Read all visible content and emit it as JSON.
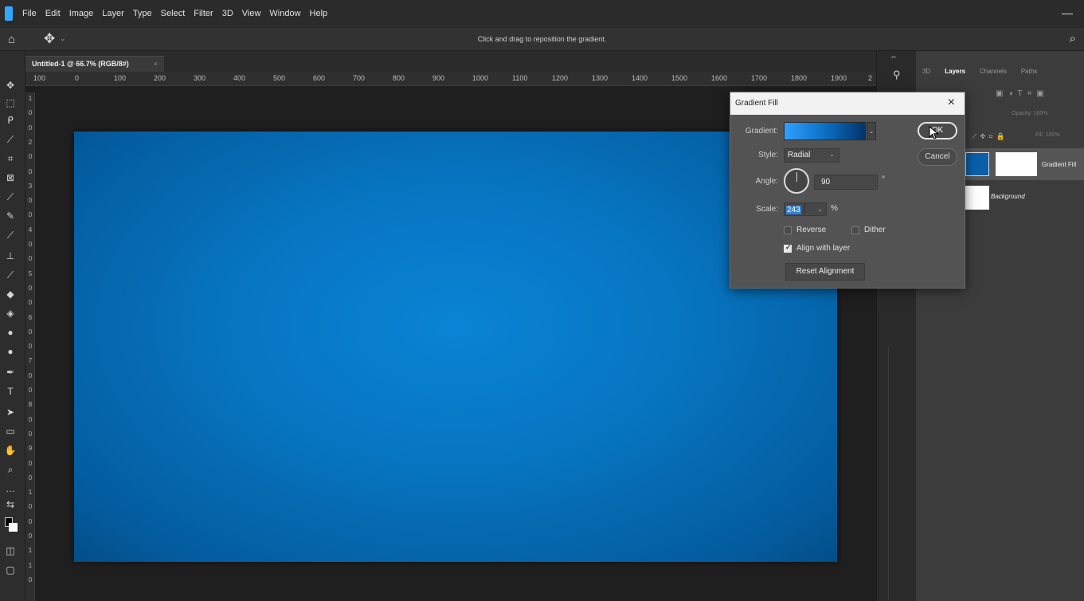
{
  "app": {
    "menu": [
      "File",
      "Edit",
      "Image",
      "Layer",
      "Type",
      "Select",
      "Filter",
      "3D",
      "View",
      "Window",
      "Help"
    ],
    "minimize_glyph": "—"
  },
  "options_bar": {
    "hint": "Click and drag to reposition the gradient."
  },
  "document": {
    "tab_title": "Untitled-1 @ 66.7% (RGB/8#)",
    "tab_close": "×"
  },
  "rulers": {
    "horizontal": [
      "100",
      "0",
      "100",
      "200",
      "300",
      "400",
      "500",
      "600",
      "700",
      "800",
      "900",
      "1000",
      "1100",
      "1200",
      "1300",
      "1400",
      "1500",
      "1600",
      "1700",
      "1800",
      "1900",
      "2"
    ],
    "vertical": [
      "1",
      "0",
      "0",
      "2",
      "0",
      "0",
      "3",
      "0",
      "0",
      "4",
      "0",
      "0",
      "5",
      "0",
      "0",
      "6",
      "0",
      "0",
      "7",
      "0",
      "0",
      "8",
      "0",
      "0",
      "9",
      "0",
      "0",
      "1",
      "0",
      "0",
      "0",
      "1",
      "1",
      "0"
    ]
  },
  "canvas": {
    "gradient_center_color": "#0a84d4",
    "gradient_edge_color": "#034d88"
  },
  "panels": {
    "tabs": [
      "3D",
      "Layers",
      "Channels",
      "Paths"
    ],
    "opacity_label": "Opacity: 100%",
    "fill_label": "Fill: 100%",
    "layers": [
      {
        "name": "Gradient Fill",
        "selected": true
      },
      {
        "name": "Background",
        "selected": false
      }
    ]
  },
  "dialog": {
    "title": "Gradient Fill",
    "close_glyph": "×",
    "gradient_label": "Gradient:",
    "style_label": "Style:",
    "style_value": "Radial",
    "angle_label": "Angle:",
    "angle_value": "90",
    "angle_unit": "°",
    "scale_label": "Scale:",
    "scale_value": "243",
    "scale_unit": "%",
    "reverse_label": "Reverse",
    "reverse_checked": false,
    "dither_label": "Dither",
    "dither_checked": false,
    "align_label": "Align with layer",
    "align_checked": true,
    "reset_label": "Reset Alignment",
    "ok_label": "OK",
    "cancel_label": "Cancel",
    "gradient_colors": [
      "#30a0ff",
      "#0b6fc4",
      "#04346a"
    ]
  }
}
